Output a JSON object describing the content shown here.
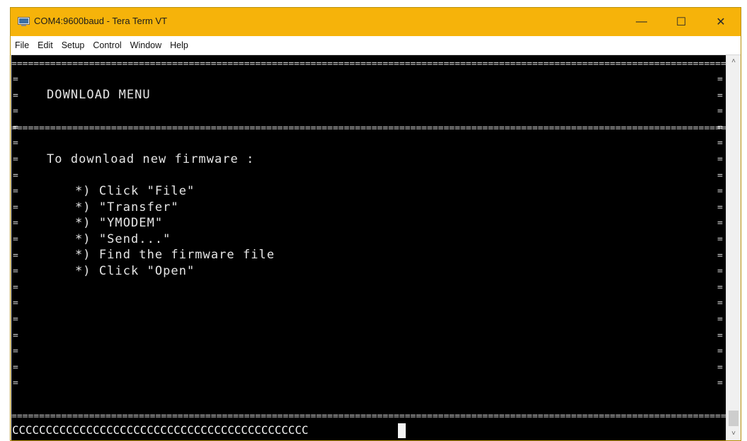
{
  "window": {
    "title": "COM4:9600baud - Tera Term VT",
    "controls": {
      "minimize": "—",
      "maximize": "☐",
      "close": "✕"
    },
    "accent_color": "#f6b30a"
  },
  "menubar": {
    "items": [
      "File",
      "Edit",
      "Setup",
      "Control",
      "Window",
      "Help"
    ]
  },
  "terminal": {
    "rule": "=================================================================================================================================================",
    "edge_char": "=",
    "heading": "DOWNLOAD MENU",
    "intro": "To download new firmware :",
    "steps": [
      "*) Click \"File\"",
      "*) \"Transfer\"",
      "*) \"YMODEM\"",
      "*) \"Send...\"",
      "*) Find the firmware file",
      "*) Click \"Open\""
    ],
    "input_line": "CCCCCCCCCCCCCCCCCCCCCCCCCCCCCCCCCCCCCCCCCCCC"
  },
  "scrollbar": {
    "up_icon": "˄",
    "down_icon": "˅"
  }
}
